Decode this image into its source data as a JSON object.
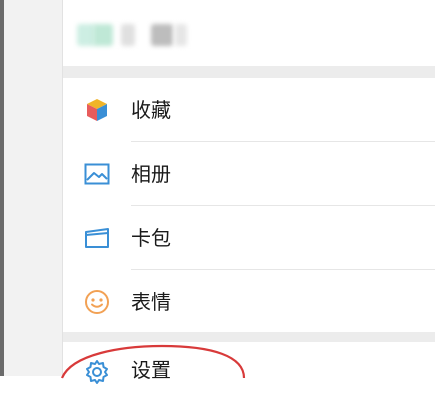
{
  "profile": {
    "blurred_name_colors": [
      "#cdeee3",
      "#bfe8d6",
      "#d9d9d9",
      "#bdbdbd",
      "#e0e0e0"
    ]
  },
  "menu": {
    "items": [
      {
        "label": "收藏",
        "icon": "cube-icon"
      },
      {
        "label": "相册",
        "icon": "image-icon"
      },
      {
        "label": "卡包",
        "icon": "card-wallet-icon"
      },
      {
        "label": "表情",
        "icon": "smiley-icon"
      }
    ],
    "settings": {
      "label": "设置",
      "icon": "gear-icon"
    }
  },
  "colors": {
    "icon_blue": "#3a8fd6",
    "icon_yellow": "#f0b429",
    "icon_red": "#e85c5c",
    "icon_orange": "#f2a154",
    "annotation_red": "#d83a3a",
    "divider": "#e6e6e6",
    "gap": "#ececec"
  }
}
